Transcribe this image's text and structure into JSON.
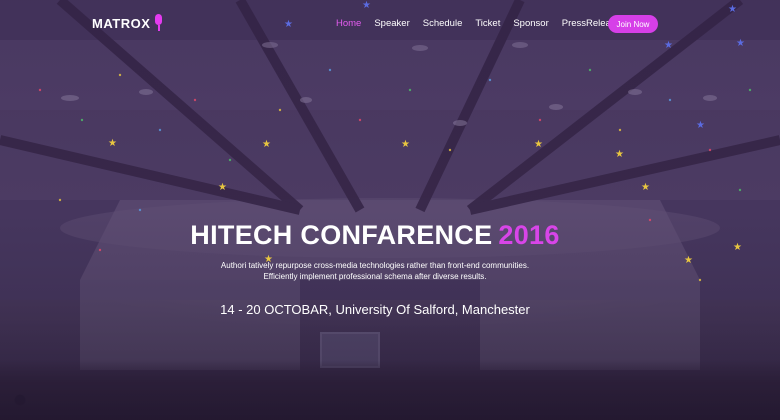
{
  "brand": {
    "name": "MATROX",
    "icon": "microphone-icon",
    "accent": "#d63fe8"
  },
  "nav": {
    "items": [
      {
        "label": "Home",
        "active": true
      },
      {
        "label": "Speaker"
      },
      {
        "label": "Schedule"
      },
      {
        "label": "Ticket"
      },
      {
        "label": "Sponsor"
      },
      {
        "label": "PressRelease"
      }
    ],
    "cta_label": "Join Now"
  },
  "hero": {
    "title": "HITECH CONFARENCE",
    "year": "2016",
    "description_line1": "Authori tatively repurpose cross-media technologies rather than front-end communities.",
    "description_line2": "Efficiently implement professional schema after diverse results.",
    "event_info": "14 - 20 OCTOBAR, University Of Salford, Manchester"
  }
}
